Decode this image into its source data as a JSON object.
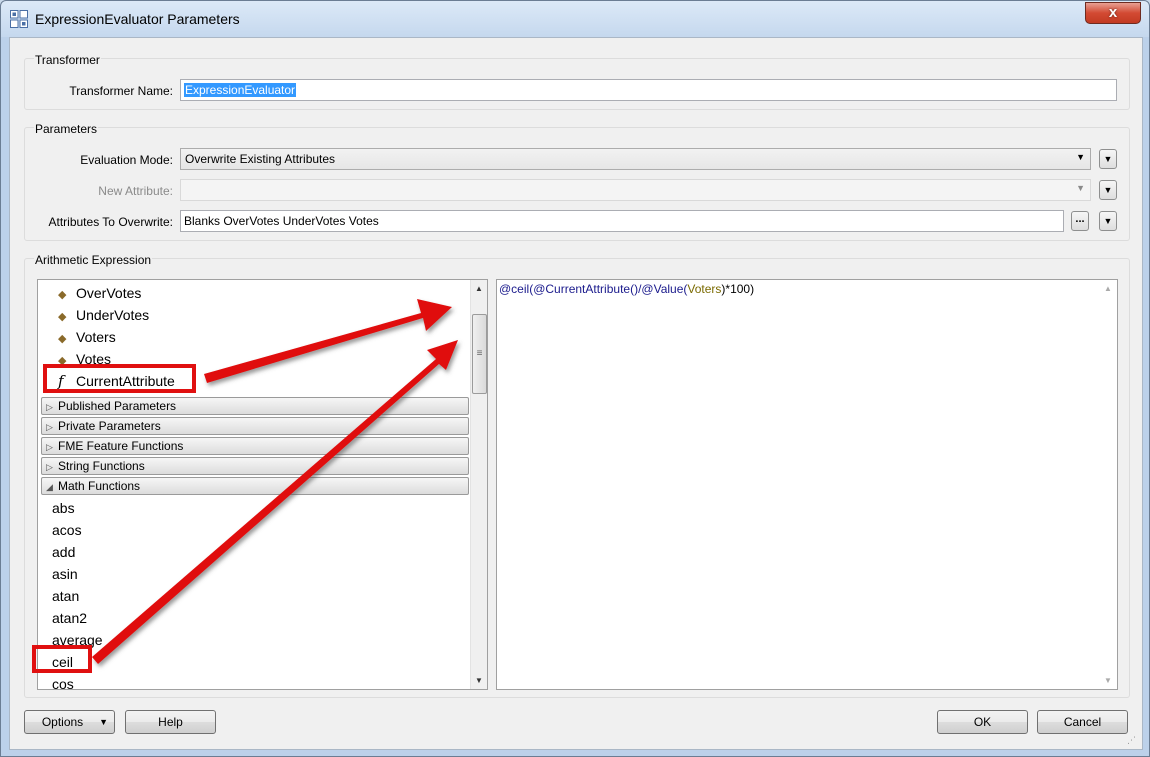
{
  "window": {
    "title": "ExpressionEvaluator Parameters",
    "close_glyph": "x",
    "icon": "transformer-grid-icon"
  },
  "transformer": {
    "group_label": "Transformer",
    "name_label": "Transformer Name:",
    "name_value": "ExpressionEvaluator"
  },
  "parameters": {
    "group_label": "Parameters",
    "evaluation_mode_label": "Evaluation Mode:",
    "evaluation_mode_value": "Overwrite Existing Attributes",
    "new_attribute_label": "New Attribute:",
    "new_attribute_value": "",
    "attributes_to_overwrite_label": "Attributes To Overwrite:",
    "attributes_to_overwrite_value": "Blanks OverVotes UnderVotes Votes",
    "ellipsis_label": "..."
  },
  "arithmetic": {
    "group_label": "Arithmetic Expression",
    "attributes": [
      "OverVotes",
      "UnderVotes",
      "Voters",
      "Votes"
    ],
    "current_attribute": "CurrentAttribute",
    "sections": [
      {
        "label": "Published Parameters",
        "expanded": false
      },
      {
        "label": "Private Parameters",
        "expanded": false
      },
      {
        "label": "FME Feature Functions",
        "expanded": false
      },
      {
        "label": "String Functions",
        "expanded": false
      },
      {
        "label": "Math Functions",
        "expanded": true
      }
    ],
    "math_functions": [
      "abs",
      "acos",
      "add",
      "asin",
      "atan",
      "atan2",
      "average",
      "ceil",
      "cos"
    ],
    "expression": {
      "p1": "@ceil(",
      "p2": "@CurrentAttribute",
      "p3": "()/",
      "p4": "@Value",
      "p5": "(",
      "p6": "Voters",
      "p7": ")*100)"
    }
  },
  "footer": {
    "options_label": "Options",
    "help_label": "Help",
    "ok_label": "OK",
    "cancel_label": "Cancel"
  },
  "colors": {
    "annotation_red": "#e01010",
    "selection_blue": "#3399ff",
    "function_token": "#1a1a8c",
    "attribute_token": "#7a6a00"
  }
}
